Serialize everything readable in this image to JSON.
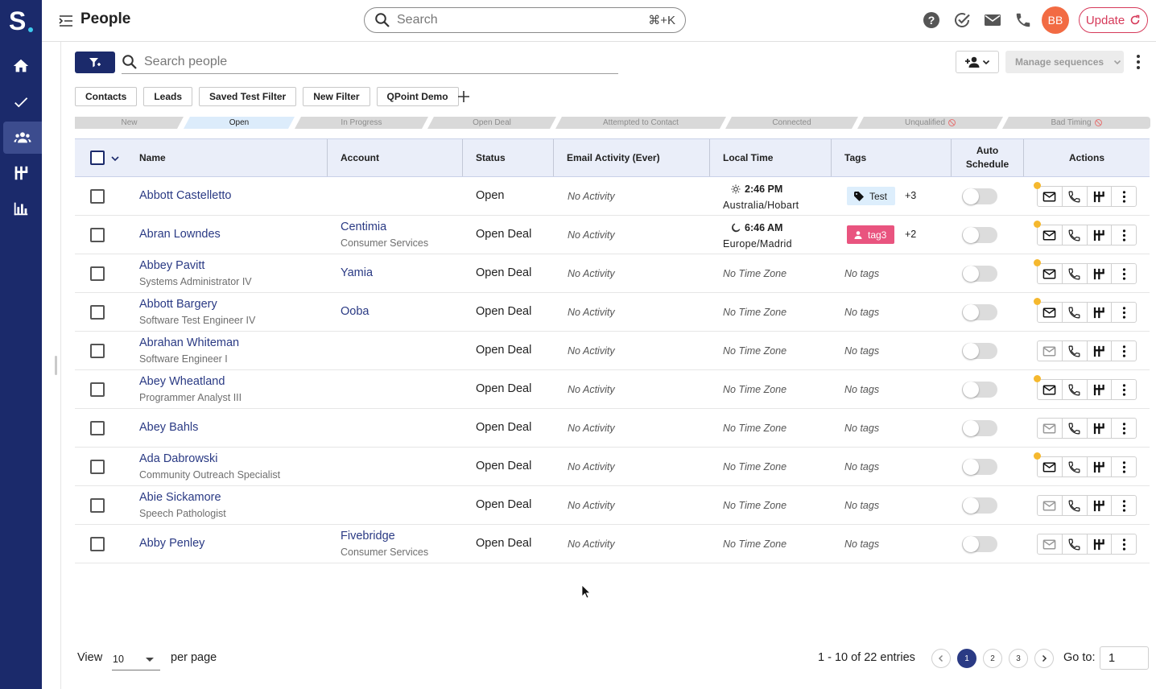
{
  "app": {
    "logo": "S",
    "page_title": "People"
  },
  "topbar": {
    "search_placeholder": "Search",
    "shortcut": "⌘+K",
    "avatar_initials": "BB",
    "update_label": "Update"
  },
  "toolbar": {
    "search_placeholder": "Search people",
    "manage_sequences": "Manage sequences"
  },
  "views": [
    "Contacts",
    "Leads",
    "Saved Test Filter",
    "New Filter",
    "QPoint Demo"
  ],
  "stages": [
    {
      "label": "New",
      "active": false,
      "banned": false
    },
    {
      "label": "Open",
      "active": true,
      "banned": false
    },
    {
      "label": "In Progress",
      "active": false,
      "banned": false
    },
    {
      "label": "Open Deal",
      "active": false,
      "banned": false
    },
    {
      "label": "Attempted to Contact",
      "active": false,
      "banned": false
    },
    {
      "label": "Connected",
      "active": false,
      "banned": false
    },
    {
      "label": "Unqualified",
      "active": false,
      "banned": true
    },
    {
      "label": "Bad Timing",
      "active": false,
      "banned": true
    }
  ],
  "columns": {
    "name": "Name",
    "account": "Account",
    "status": "Status",
    "email": "Email Activity (Ever)",
    "local_time": "Local Time",
    "tags": "Tags",
    "auto": "Auto Schedule",
    "actions": "Actions"
  },
  "rows": [
    {
      "name": "Abbott Castelletto",
      "title": "",
      "account": "",
      "account_sub": "",
      "status": "Open",
      "email": "No Activity",
      "time": "2:46 PM",
      "time_kind": "day",
      "zone": "Australia/Hobart",
      "tag": "Test",
      "tag_style": "test",
      "tag_more": "+3",
      "no_tags": "",
      "no_zone": "",
      "email_alert": true,
      "email_enabled": true
    },
    {
      "name": "Abran Lowndes",
      "title": "",
      "account": "Centimia",
      "account_sub": "Consumer Services",
      "status": "Open Deal",
      "email": "No Activity",
      "time": "6:46 AM",
      "time_kind": "night",
      "zone": "Europe/Madrid",
      "tag": "tag3",
      "tag_style": "pink",
      "tag_more": "+2",
      "no_tags": "",
      "no_zone": "",
      "email_alert": true,
      "email_enabled": true
    },
    {
      "name": "Abbey Pavitt",
      "title": "Systems Administrator IV",
      "account": "Yamia",
      "account_sub": "",
      "status": "Open Deal",
      "email": "No Activity",
      "no_zone": "No Time Zone",
      "no_tags": "No tags",
      "email_alert": true,
      "email_enabled": true
    },
    {
      "name": "Abbott Bargery",
      "title": "Software Test Engineer IV",
      "account": "Ooba",
      "account_sub": "",
      "status": "Open Deal",
      "email": "No Activity",
      "no_zone": "No Time Zone",
      "no_tags": "No tags",
      "email_alert": true,
      "email_enabled": true
    },
    {
      "name": "Abrahan Whiteman",
      "title": "Software Engineer I",
      "account": "",
      "account_sub": "",
      "status": "Open Deal",
      "email": "No Activity",
      "no_zone": "No Time Zone",
      "no_tags": "No tags",
      "email_alert": false,
      "email_enabled": false
    },
    {
      "name": "Abey Wheatland",
      "title": "Programmer Analyst III",
      "account": "",
      "account_sub": "",
      "status": "Open Deal",
      "email": "No Activity",
      "no_zone": "No Time Zone",
      "no_tags": "No tags",
      "email_alert": true,
      "email_enabled": true
    },
    {
      "name": "Abey Bahls",
      "title": "",
      "account": "",
      "account_sub": "",
      "status": "Open Deal",
      "email": "No Activity",
      "no_zone": "No Time Zone",
      "no_tags": "No tags",
      "email_alert": false,
      "email_enabled": false
    },
    {
      "name": "Ada Dabrowski",
      "title": "Community Outreach Specialist",
      "account": "",
      "account_sub": "",
      "status": "Open Deal",
      "email": "No Activity",
      "no_zone": "No Time Zone",
      "no_tags": "No tags",
      "email_alert": true,
      "email_enabled": true
    },
    {
      "name": "Abie Sickamore",
      "title": "Speech Pathologist",
      "account": "",
      "account_sub": "",
      "status": "Open Deal",
      "email": "No Activity",
      "no_zone": "No Time Zone",
      "no_tags": "No tags",
      "email_alert": false,
      "email_enabled": false
    },
    {
      "name": "Abby Penley",
      "title": "",
      "account": "Fivebridge",
      "account_sub": "Consumer Services",
      "status": "Open Deal",
      "email": "No Activity",
      "no_zone": "No Time Zone",
      "no_tags": "No tags",
      "email_alert": false,
      "email_enabled": false
    }
  ],
  "footer": {
    "view_label": "View",
    "per_page_value": "10",
    "per_page_label": "per page",
    "entries": "1 - 10 of 22 entries",
    "pages": [
      "1",
      "2",
      "3"
    ],
    "current_page": "1",
    "goto_label": "Go to:",
    "goto_value": "1"
  },
  "colors": {
    "nav": "#1b2a6b",
    "link": "#2a3a84",
    "update": "#d63a5a",
    "avatar": "#f26b43",
    "tag_pink": "#e9547f",
    "alert": "#f5b82e"
  }
}
